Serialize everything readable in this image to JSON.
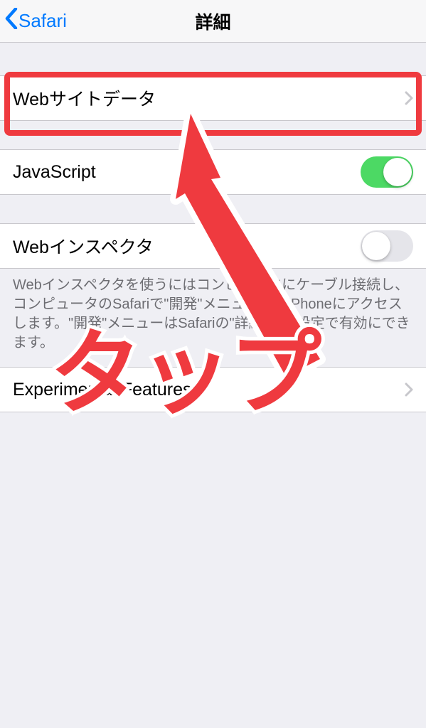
{
  "nav": {
    "back_label": "Safari",
    "title": "詳細"
  },
  "rows": {
    "website_data": {
      "label": "Webサイトデータ"
    },
    "javascript": {
      "label": "JavaScript",
      "enabled": true
    },
    "web_inspector": {
      "label": "Webインスペクタ",
      "enabled": false
    },
    "experimental": {
      "label": "Experimental Features"
    }
  },
  "web_inspector_footer": "Webインスペクタを使うにはコンピュータにケーブル接続し、コンピュータのSafariで\"開発\"メニューからiPhoneにアクセスします。\"開発\"メニューはSafariの\"詳細\"環境設定で有効にできます。",
  "annotation": {
    "label": "タップ",
    "color": "#ef3a3f"
  }
}
